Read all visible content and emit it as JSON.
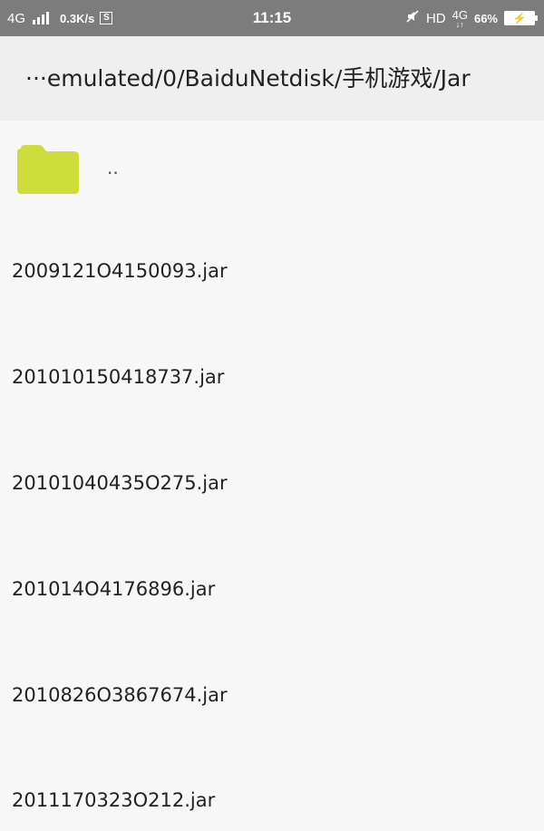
{
  "status_bar": {
    "network": "4G",
    "speed": "0.3K/s",
    "s_icon": "S",
    "time": "11:15",
    "hd": "HD",
    "data_net": "4G",
    "battery_pct": "66%"
  },
  "path": {
    "text": "···emulated/0/BaiduNetdisk/手机游戏/Jar"
  },
  "parent_dir": {
    "label": ".."
  },
  "files": [
    {
      "name": "2009121O4150093.jar"
    },
    {
      "name": "201010150418737.jar"
    },
    {
      "name": "20101040435O275.jar"
    },
    {
      "name": "201014O4176896.jar"
    },
    {
      "name": "2010826O3867674.jar"
    },
    {
      "name": "2011170323O212.jar"
    }
  ],
  "colors": {
    "status_bg": "#7c7c7c",
    "header_bg": "#efefef",
    "page_bg": "#f7f7f7",
    "folder": "#cfdd3c"
  }
}
